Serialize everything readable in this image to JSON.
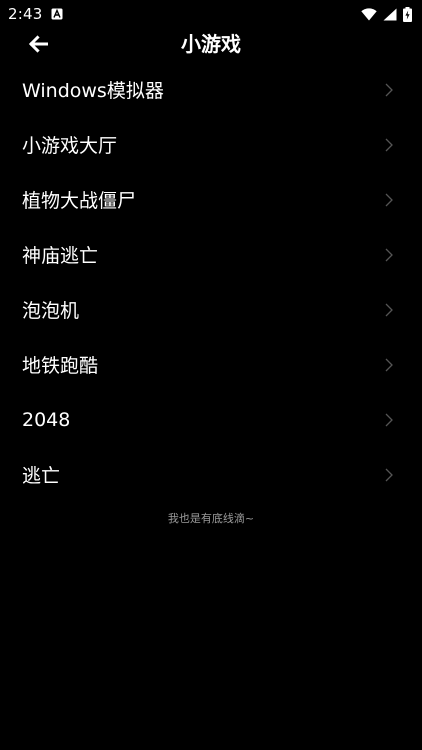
{
  "status_bar": {
    "time": "2:43",
    "icons": [
      "a-notification-icon",
      "wifi-icon",
      "cellular-signal-icon",
      "battery-charging-icon"
    ]
  },
  "toolbar": {
    "back_icon": "arrow-left-icon",
    "title": "小游戏"
  },
  "menu": {
    "items": [
      {
        "label": "Windows模拟器"
      },
      {
        "label": "小游戏大厅"
      },
      {
        "label": "植物大战僵尸"
      },
      {
        "label": "神庙逃亡"
      },
      {
        "label": "泡泡机"
      },
      {
        "label": "地铁跑酷"
      },
      {
        "label": "2048"
      },
      {
        "label": "逃亡"
      }
    ],
    "chevron_icon": "chevron-right-icon"
  },
  "footer": {
    "text": "我也是有底线滴~"
  },
  "colors": {
    "background": "#000000",
    "text": "#ffffff",
    "muted": "#9a9a9a",
    "chevron": "#555555"
  }
}
